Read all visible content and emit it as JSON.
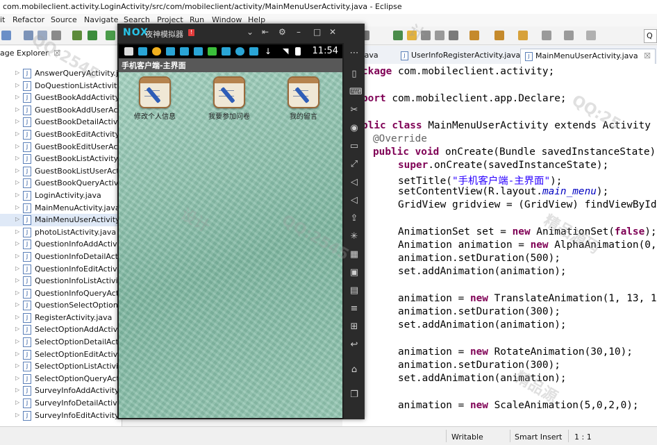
{
  "window": {
    "title": "com.mobileclient.activity.LoginActivity/src/com/mobileclient/activity/MainMenuUserActivity.java - Eclipse"
  },
  "menubar": [
    "it",
    "Refactor",
    "Source",
    "Navigate",
    "Search",
    "Project",
    "Run",
    "Window",
    "Help"
  ],
  "package_explorer": {
    "tab_label": "age Explorer",
    "close_glyph": "☒",
    "files": [
      "AnswerQueryActivity.java",
      "DoQuestionListActivity.j",
      "GuestBookAddActivity.j",
      "GuestBookAddUserActi",
      "GuestBookDetailActivity",
      "GuestBookEditActivity.ja",
      "GuestBookEditUserActi",
      "GuestBookListActivity.ja",
      "GuestBookListUserActiv",
      "GuestBookQueryActivit",
      "LoginActivity.java",
      "MainMenuActivity.java",
      "MainMenuUserActivity.j",
      "photoListActivity.java",
      "QuestionInfoAddActivi",
      "QuestionInfoDetailActiv",
      "QuestionInfoEditActivity",
      "QuestionInfoListActivity",
      "QuestionInfoQueryActiv",
      "QuestionSelectOptionLi",
      "RegisterActivity.java",
      "SelectOptionAddActivit",
      "SelectOptionDetailActiv",
      "SelectOptionEditActivity",
      "SelectOptionListActivity.",
      "SelectOptionQueryActiv",
      "SurveyInfoAddActivity.ja",
      "SurveyInfoDetailActivity",
      "SurveyInfoEditActivity.ja"
    ],
    "selected_index": 12
  },
  "toolbar": {
    "search_glyph": "Q"
  },
  "editor": {
    "tabs": [
      {
        "label": "l.java",
        "active": false
      },
      {
        "label": "UserInfoRegisterActivity.java",
        "active": false
      },
      {
        "label": "MainMenuUserActivity.java",
        "active": true
      }
    ],
    "tab_close_glyph": "☒",
    "code": [
      "ckage com.mobileclient.activity;",
      "",
      "port com.mobileclient.app.Declare;",
      "",
      "blic class MainMenuUserActivity extends Activity {",
      "  @Override",
      "  public void onCreate(Bundle savedInstanceState) {",
      "     super.onCreate(savedInstanceState);",
      "     setTitle(\"手机客户端-主界面\");",
      "     setContentView(R.layout.main_menu);",
      "     GridView gridview = (GridView) findViewById(",
      "",
      "     AnimationSet set = new AnimationSet(false);",
      "     Animation animation = new AlphaAnimation(0,",
      "     animation.setDuration(500);",
      "     set.addAnimation(animation);",
      "",
      "     animation = new TranslateAnimation(1, 13, 1",
      "     animation.setDuration(300);",
      "     set.addAnimation(animation);",
      "",
      "     animation = new RotateAnimation(30,10);",
      "     animation.setDuration(300);",
      "     set.addAnimation(animation);",
      "",
      "     animation = new ScaleAnimation(5,0,2,0);"
    ]
  },
  "statusbar": {
    "writable": "Writable",
    "insert_mode": "Smart Insert",
    "position": "1 : 1"
  },
  "emulator": {
    "logo": "NOX",
    "title": "夜神模拟器",
    "badge": "!",
    "window_controls": [
      "⌄",
      "⇤",
      "⚙",
      "–",
      "□",
      "✕"
    ],
    "clock": "11:54",
    "app_title": "手机客户端-主界面",
    "grid_items": [
      "修改个人信息",
      "我要参加问卷",
      "我的留言"
    ]
  },
  "watermarks": [
    "QQ:2545",
    "计",
    "精品源码",
    "QQ:2545",
    "精品源",
    "设计",
    "QQ:25"
  ]
}
